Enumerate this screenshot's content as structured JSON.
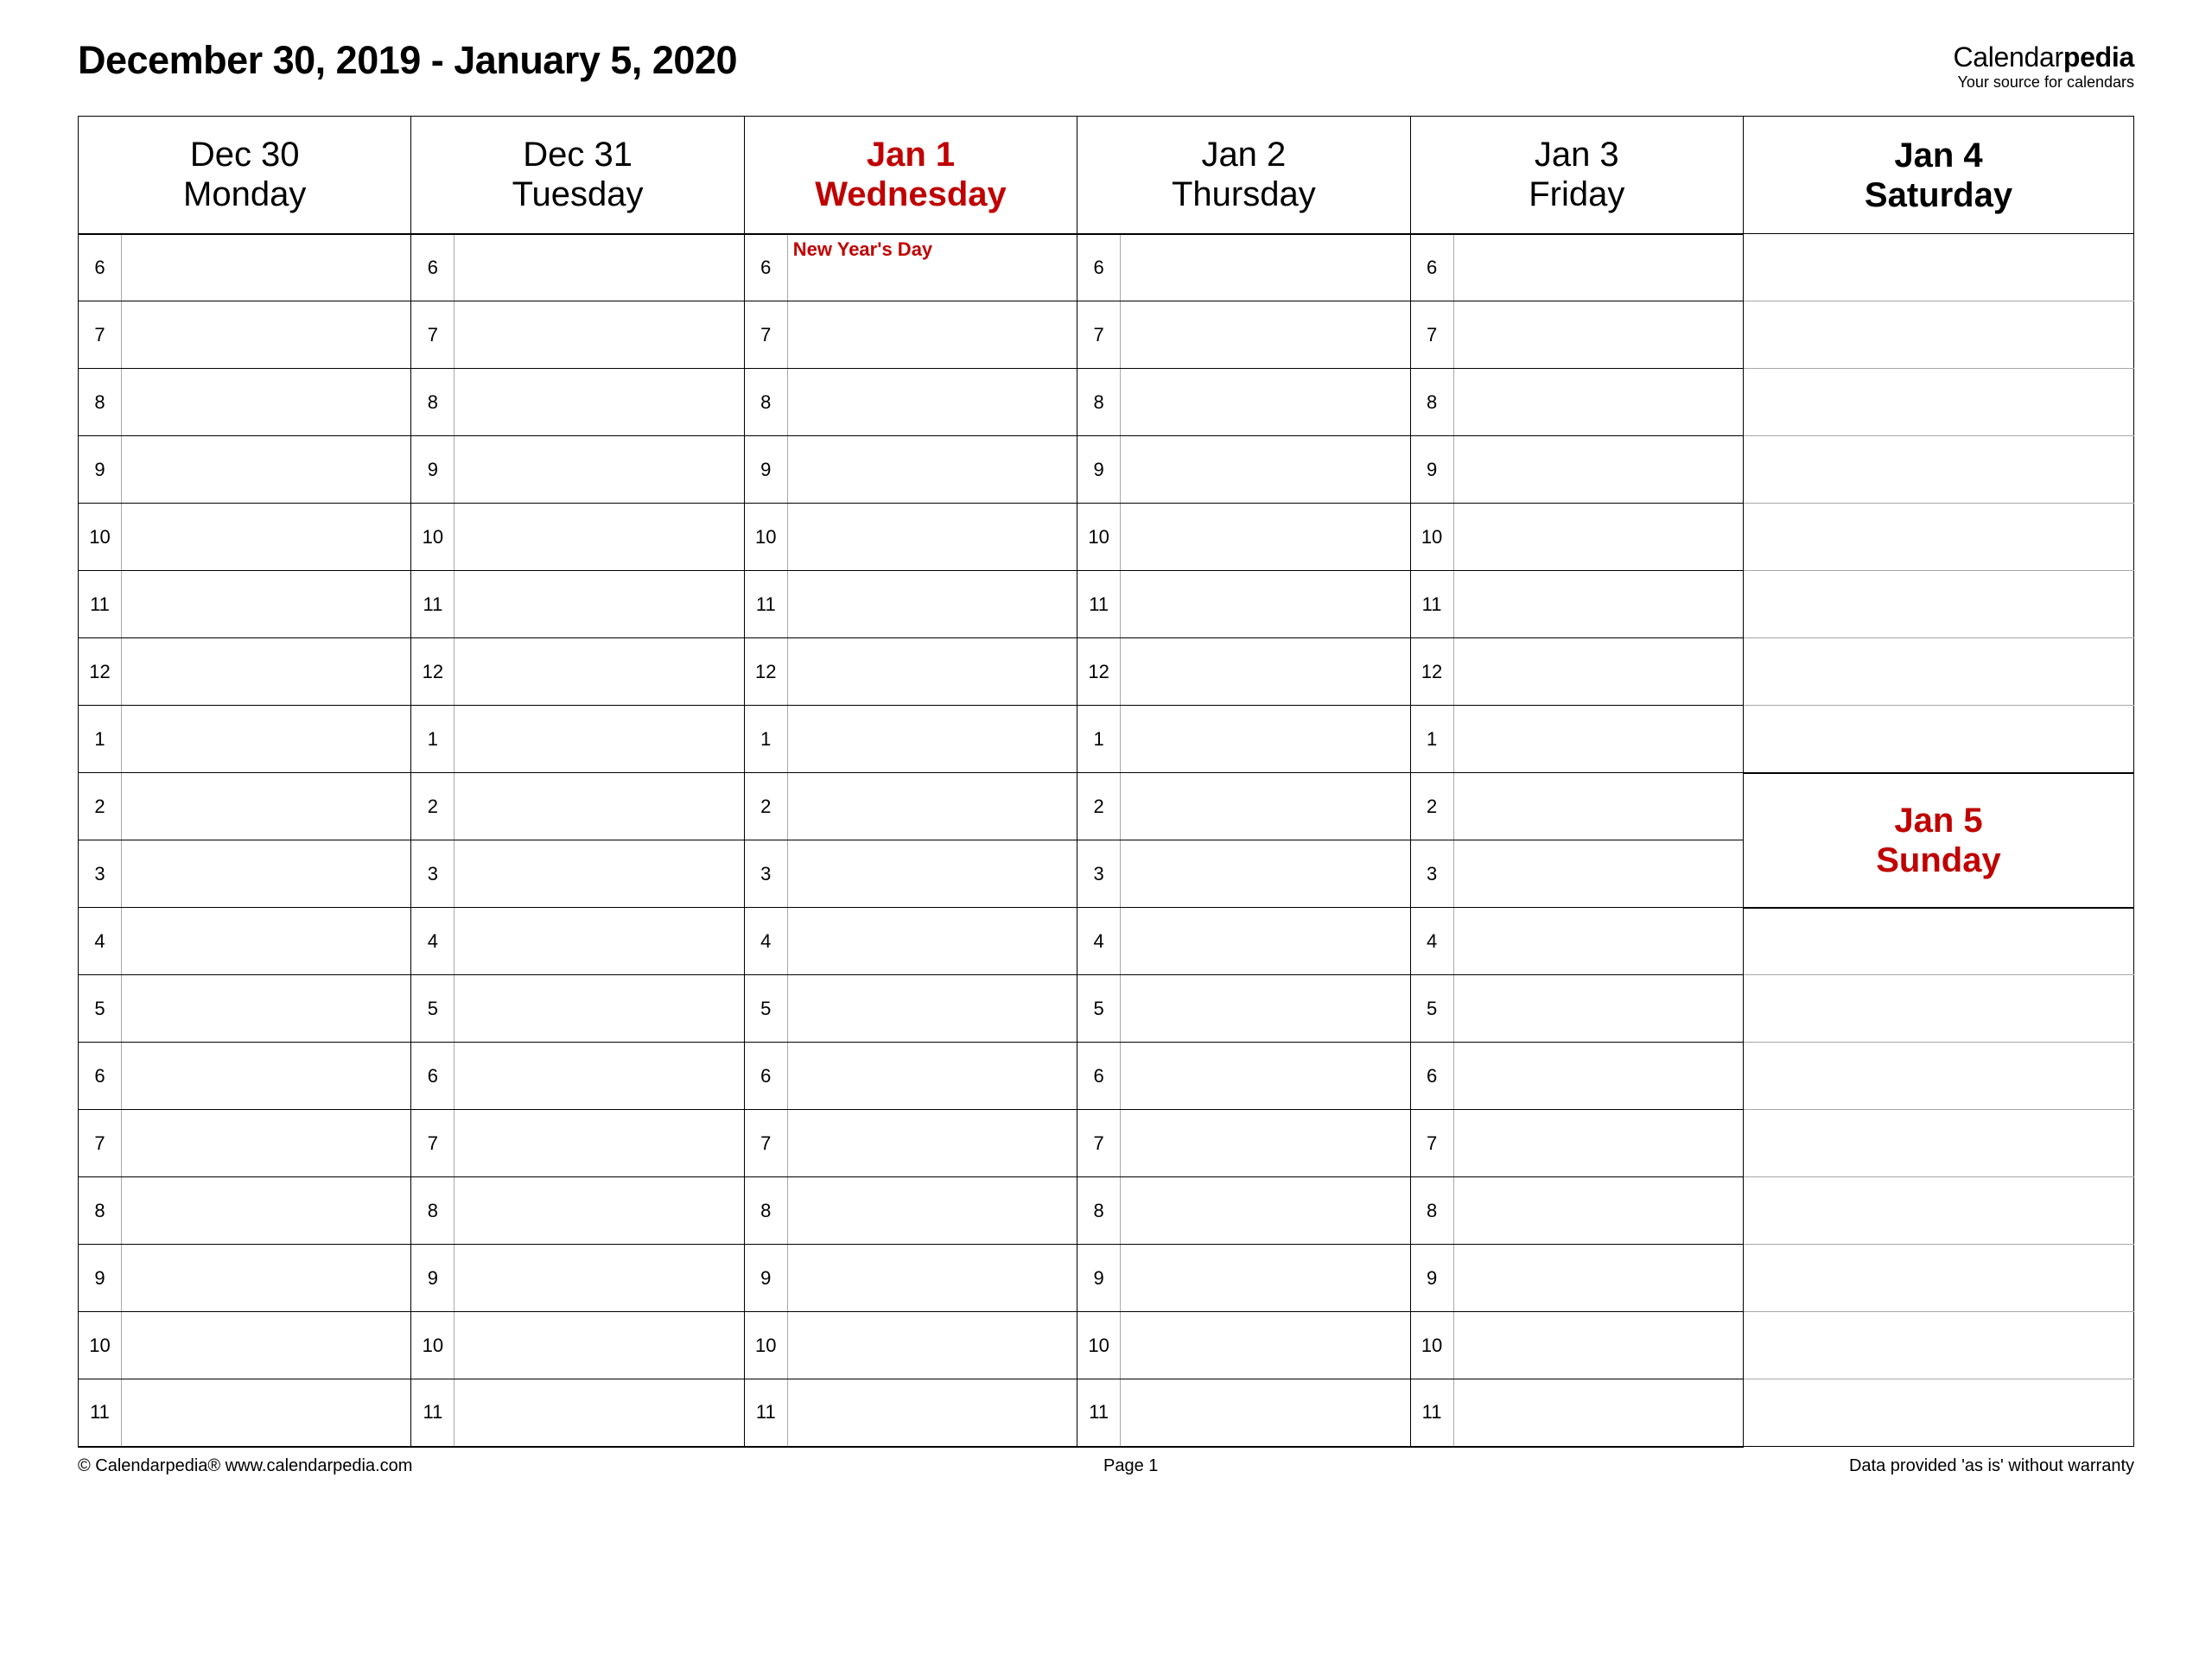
{
  "title": "December 30, 2019 - January 5, 2020",
  "brand": {
    "name_part1": "Calendar",
    "name_part2": "pedia",
    "tagline": "Your source for calendars"
  },
  "days": [
    {
      "date": "Dec 30",
      "dow": "Monday",
      "holiday": false,
      "weekend": false,
      "event": ""
    },
    {
      "date": "Dec 31",
      "dow": "Tuesday",
      "holiday": false,
      "weekend": false,
      "event": ""
    },
    {
      "date": "Jan 1",
      "dow": "Wednesday",
      "holiday": true,
      "weekend": false,
      "event": "New Year's Day"
    },
    {
      "date": "Jan 2",
      "dow": "Thursday",
      "holiday": false,
      "weekend": false,
      "event": ""
    },
    {
      "date": "Jan 3",
      "dow": "Friday",
      "holiday": false,
      "weekend": false,
      "event": ""
    },
    {
      "date": "Jan 4",
      "dow": "Saturday",
      "holiday": false,
      "weekend": true,
      "event": ""
    }
  ],
  "sunday": {
    "date": "Jan 5",
    "dow": "Sunday"
  },
  "hours": [
    "6",
    "7",
    "8",
    "9",
    "10",
    "11",
    "12",
    "1",
    "2",
    "3",
    "4",
    "5",
    "6",
    "7",
    "8",
    "9",
    "10",
    "11"
  ],
  "footer": {
    "left": "© Calendarpedia®   www.calendarpedia.com",
    "center": "Page 1",
    "right": "Data provided 'as is' without warranty"
  }
}
